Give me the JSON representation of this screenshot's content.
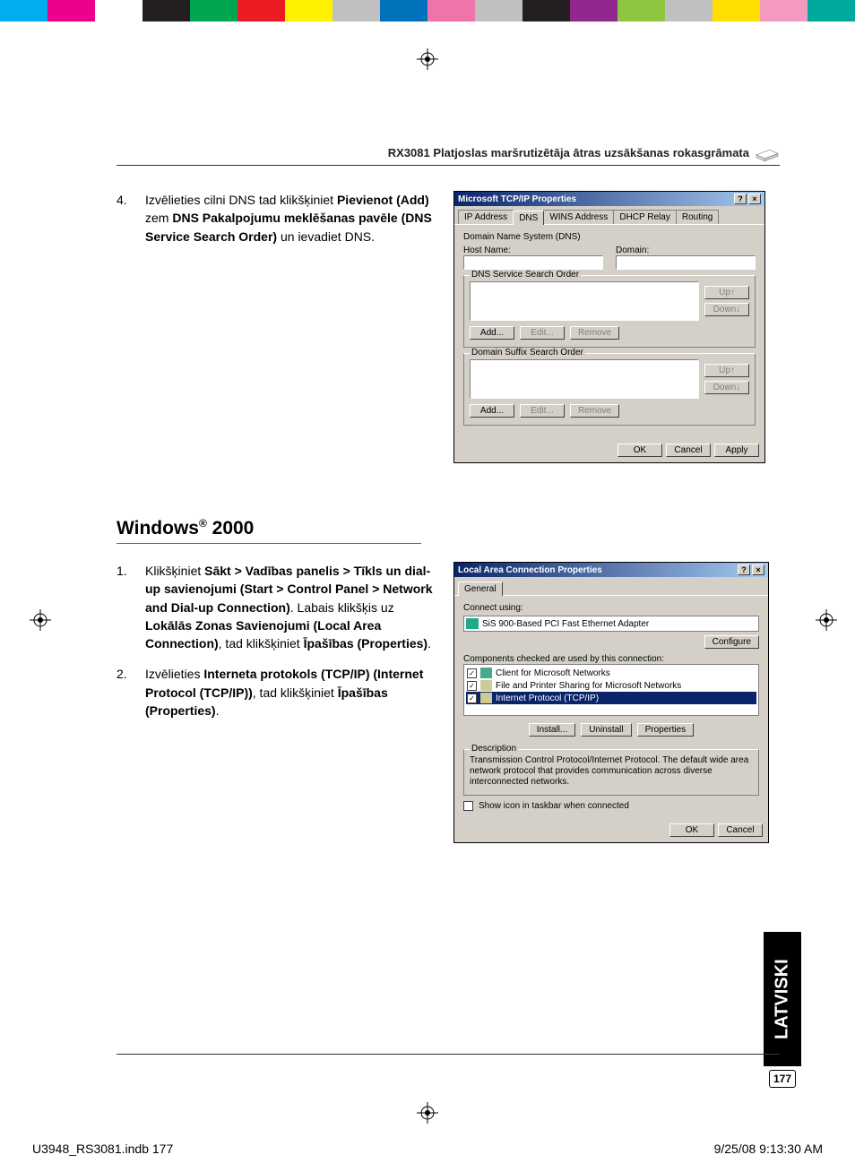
{
  "colorbar": [
    "#00aeef",
    "#ec008c",
    "#ffffff",
    "#231f20",
    "#00a651",
    "#ed1c24",
    "#fff200",
    "#c0c0c0",
    "#0072bc",
    "#f173ac",
    "#c0c0c0",
    "#231f20",
    "#92278f",
    "#8dc63f",
    "#c0c0c0",
    "#ffde00",
    "#f49ac1",
    "#00a99d"
  ],
  "header": {
    "title": "RX3081 Platjoslas maršrutizētāja ātras uzsākšanas rokasgrāmata"
  },
  "step4": {
    "num": "4.",
    "t1": "Izvēlieties cilni DNS tad klikšķiniet ",
    "b1": "Pievienot (Add)",
    "t2": " zem ",
    "b2": "DNS Pakalpojumu meklēšanas pavēle (DNS Service Search Order)",
    "t3": " un ievadiet DNS."
  },
  "section_title": "Windows® 2000",
  "step1": {
    "num": "1.",
    "t1": "Klikšķiniet ",
    "b1": "Sākt > Vadības panelis > Tīkls un dial-up savienojumi (Start > Control Panel > Network and Dial-up Connection)",
    "t2": ". Labais klikšķis uz ",
    "b2": "Lokālās Zonas Savienojumi (Local Area Connection)",
    "t3": ", tad klikšķiniet ",
    "b3": "Īpašības (Properties)",
    "t4": "."
  },
  "step2": {
    "num": "2.",
    "t1": "Izvēlieties ",
    "b1": "Interneta protokols (TCP/IP) (Internet Protocol (TCP/IP))",
    "t2": ", tad klikšķiniet ",
    "b2": "Īpašības (Properties)",
    "t3": "."
  },
  "dlg1": {
    "title": "Microsoft TCP/IP Properties",
    "tabs": [
      "IP Address",
      "DNS",
      "WINS Address",
      "DHCP Relay",
      "Routing"
    ],
    "active_tab": 1,
    "dns_label": "Domain Name System (DNS)",
    "host": "Host Name:",
    "domain": "Domain:",
    "gb1": "DNS Service Search Order",
    "gb2": "Domain Suffix Search Order",
    "up": "Up↑",
    "down": "Down↓",
    "add": "Add...",
    "edit": "Edit...",
    "remove": "Remove",
    "ok": "OK",
    "cancel": "Cancel",
    "apply": "Apply"
  },
  "dlg2": {
    "title": "Local Area Connection Properties",
    "tab": "General",
    "connect_using": "Connect using:",
    "adapter": "SiS 900-Based PCI Fast Ethernet Adapter",
    "configure": "Configure",
    "components_label": "Components checked are used by this connection:",
    "items": [
      {
        "chk": "✓",
        "label": "Client for Microsoft Networks"
      },
      {
        "chk": "✓",
        "label": "File and Printer Sharing for Microsoft Networks"
      },
      {
        "chk": "✓",
        "label": "Internet Protocol (TCP/IP)"
      }
    ],
    "install": "Install...",
    "uninstall": "Uninstall",
    "properties": "Properties",
    "desc_label": "Description",
    "desc": "Transmission Control Protocol/Internet Protocol. The default wide area network protocol that provides communication across diverse interconnected networks.",
    "showicon": "Show icon in taskbar when connected",
    "ok": "OK",
    "cancel": "Cancel"
  },
  "side_tab": "LATVISKI",
  "page_number": "177",
  "footer": {
    "left": "U3948_RS3081.indb   177",
    "right": "9/25/08   9:13:30 AM"
  }
}
